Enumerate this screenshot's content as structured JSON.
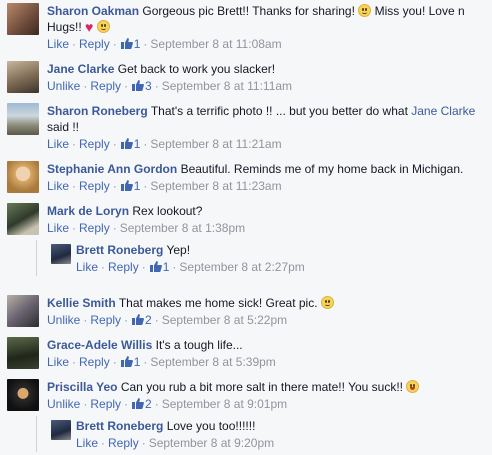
{
  "actions": {
    "like": "Like",
    "unlike": "Unlike",
    "reply": "Reply",
    "separator": "·"
  },
  "comments": [
    {
      "author": "Sharon Oakman",
      "text_1": "Gorgeous pic Brett!! Thanks for sharing!",
      "text_2": "Miss you! Love n Hugs!!",
      "liked": false,
      "like_count": "1",
      "timestamp": "September 8 at 11:08am"
    },
    {
      "author": "Jane Clarke",
      "text": "Get back to work you slacker!",
      "liked": true,
      "like_count": "3",
      "timestamp": "September 8 at 11:11am"
    },
    {
      "author": "Sharon Roneberg",
      "text_1": "That's a terrific photo !! ... but you better do what",
      "mention": "Jane Clarke",
      "text_2": "said !!",
      "liked": false,
      "like_count": "1",
      "timestamp": "September 8 at 11:21am"
    },
    {
      "author": "Stephanie Ann Gordon",
      "text": "Beautiful. Reminds me of my home back in Michigan.",
      "liked": false,
      "like_count": "1",
      "timestamp": "September 8 at 11:23am"
    },
    {
      "author": "Mark de Loryn",
      "text": "Rex lookout?",
      "liked": false,
      "like_count": "",
      "timestamp": "September 8 at 1:38pm",
      "replies": [
        {
          "author": "Brett Roneberg",
          "text": "Yep!",
          "liked": false,
          "like_count": "1",
          "timestamp": "September 8 at 2:27pm"
        }
      ]
    },
    {
      "author": "Kellie Smith",
      "text": "That makes me home sick! Great pic.",
      "liked": true,
      "like_count": "2",
      "timestamp": "September 8 at 5:22pm"
    },
    {
      "author": "Grace-Adele Willis",
      "text": "It's a tough life...",
      "liked": false,
      "like_count": "1",
      "timestamp": "September 8 at 5:39pm"
    },
    {
      "author": "Priscilla Yeo",
      "text": "Can you rub a bit more salt in there mate!! You suck!!",
      "liked": true,
      "like_count": "2",
      "timestamp": "September 8 at 9:01pm",
      "replies": [
        {
          "author": "Brett Roneberg",
          "text": "Love you too!!!!!!",
          "liked": false,
          "like_count": "",
          "timestamp": "September 8 at 9:20pm"
        }
      ]
    }
  ],
  "icons": {
    "like": "thumbs-up-icon",
    "smiley": "smiley-emoji-icon",
    "tongue": "tongue-out-emoji-icon",
    "heart": "heart-emoji-icon"
  },
  "colors": {
    "link": "#3b5998",
    "action": "#4267b2",
    "meta": "#90949c",
    "background": "#f6f7f9"
  }
}
